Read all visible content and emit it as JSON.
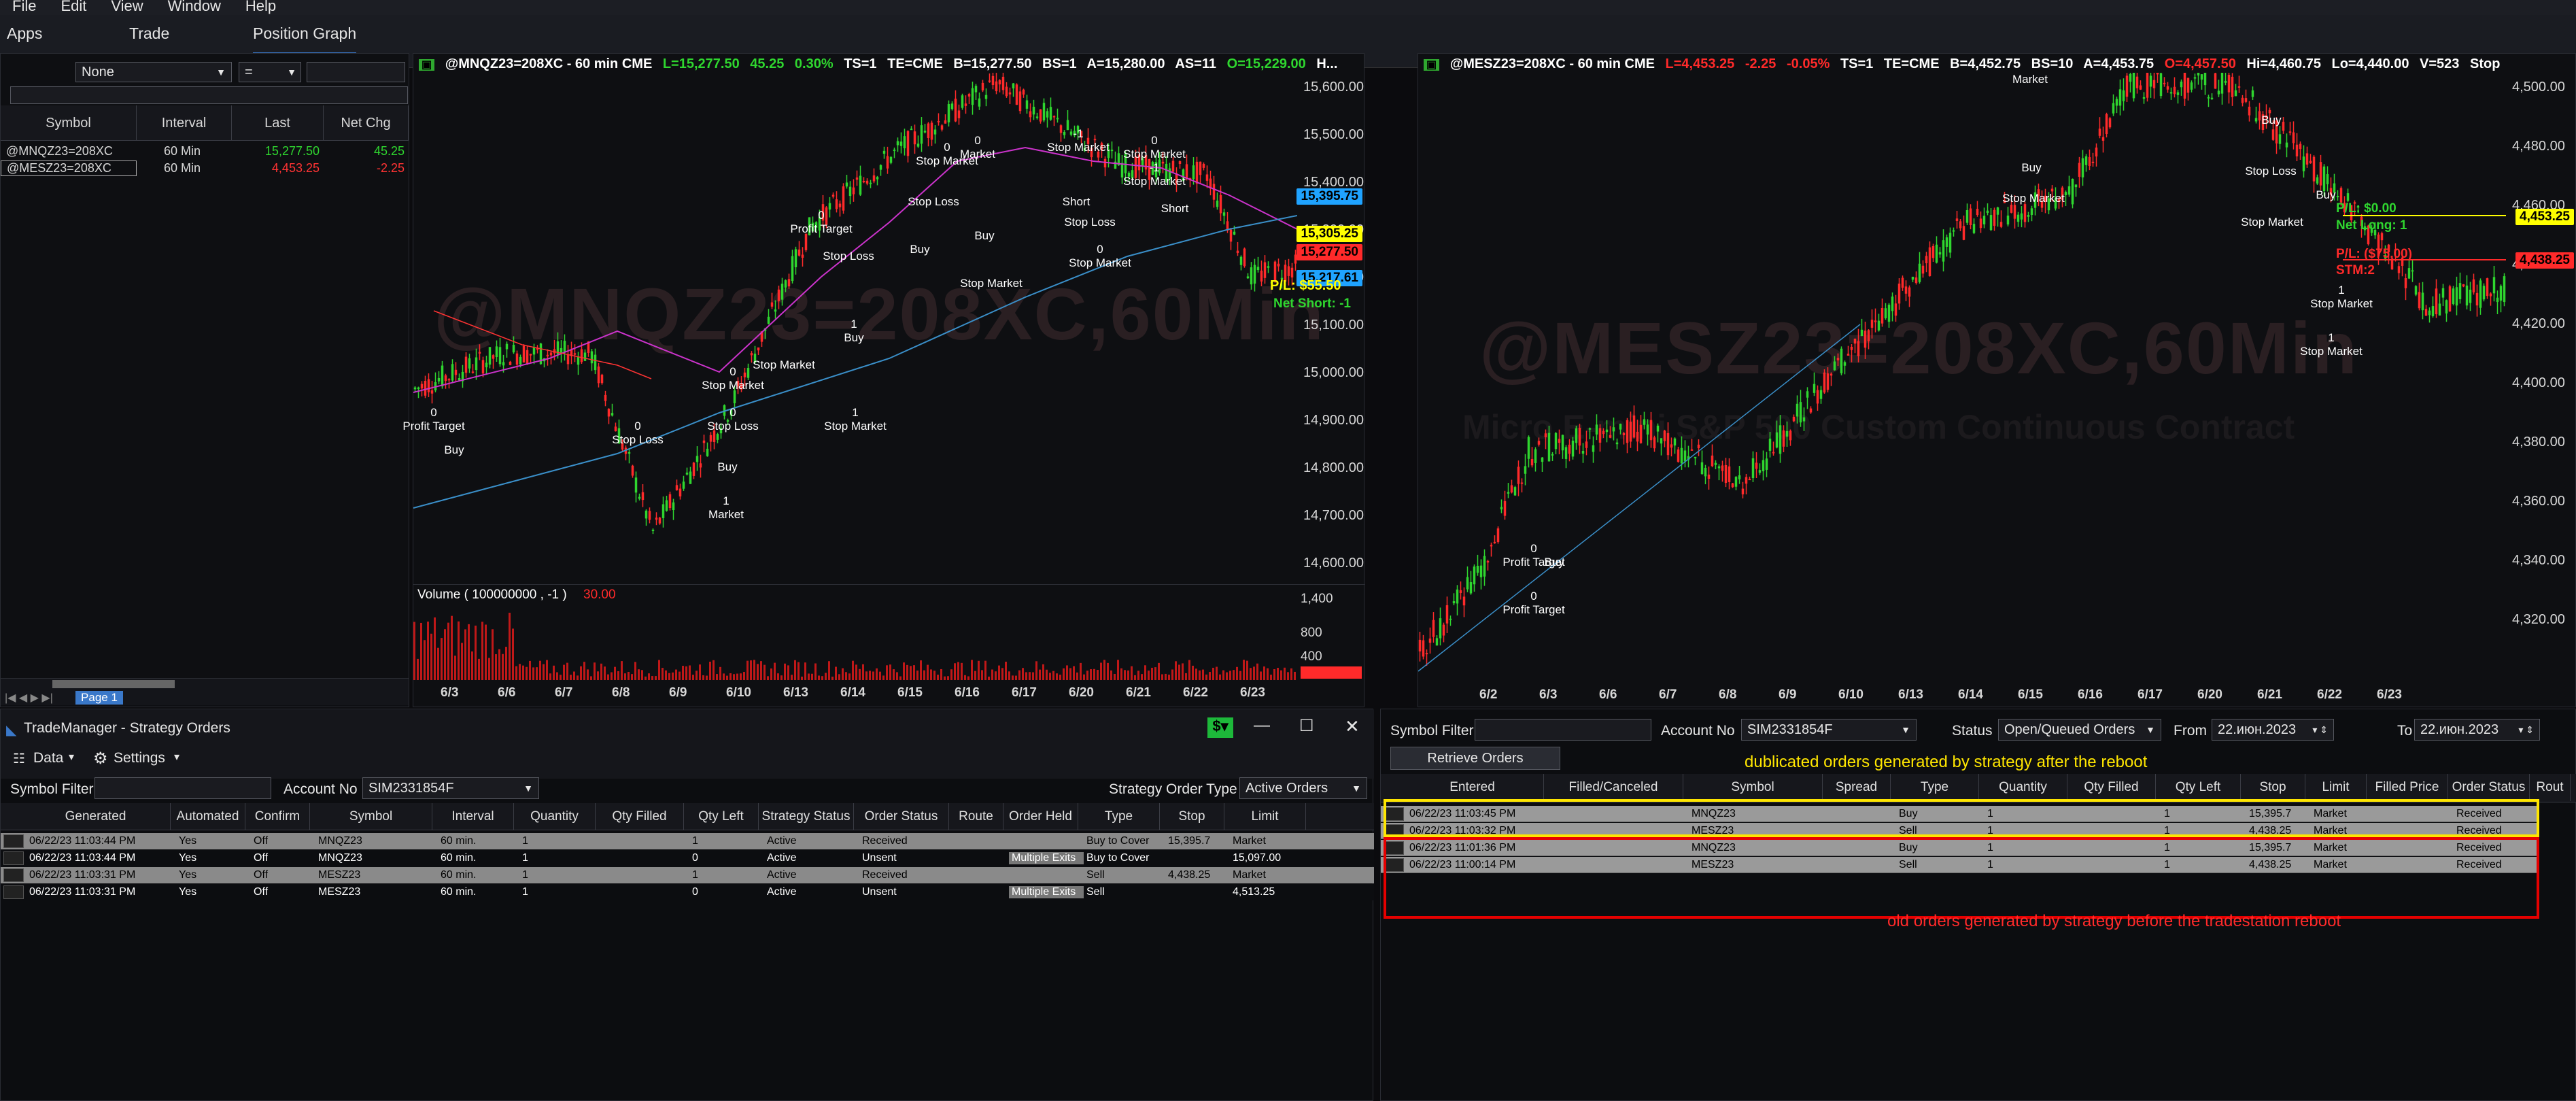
{
  "menu": [
    "File",
    "Edit",
    "View",
    "Window",
    "Help"
  ],
  "tabs": [
    {
      "label": "Apps"
    },
    {
      "label": "Trade"
    },
    {
      "label": "Position Graph"
    }
  ],
  "quotelist": {
    "filter_value": "None",
    "filter2": "=",
    "headers": [
      "Symbol",
      "Interval",
      "Last",
      "Net Chg"
    ],
    "rows": [
      {
        "symbol": "@MNQZ23=208XC",
        "interval": "60 Min",
        "last": "15,277.50",
        "net_chg": "45.25",
        "color": "#2fd62f"
      },
      {
        "symbol": "@MESZ23=208XC",
        "interval": "60 Min",
        "last": "4,453.25",
        "net_chg": "-2.25",
        "color": "#ff3333"
      }
    ],
    "page_tab": "Page 1"
  },
  "chart_left": {
    "title": {
      "symbol": "@MNQZ23=208XC - 60 min  CME",
      "last": "L=15,277.50",
      "chg": "45.25",
      "pct": "0.30%",
      "ts": "TS=1",
      "te": "TE=CME",
      "bid": "B=15,277.50",
      "bs": "BS=1",
      "ask": "A=15,280.00",
      "as": "AS=11",
      "open": "O=15,229.00",
      "hi": "H..."
    },
    "watermark": "@MNQZ23=208XC,60Min",
    "y_ticks": [
      "15,600.00",
      "15,500.00",
      "15,400.00",
      "15,300.00",
      "15,200.00",
      "15,100.00",
      "15,000.00",
      "14,900.00",
      "14,800.00",
      "14,700.00",
      "14,600.00"
    ],
    "price_tags": [
      {
        "text": "15,395.75",
        "bg": "#1fa3ff",
        "fg": "#000"
      },
      {
        "text": "15,305.25",
        "bg": "#ffff00",
        "fg": "#000"
      },
      {
        "text": "15,277.50",
        "bg": "#ff2a2a",
        "fg": "#000"
      },
      {
        "text": "15,217.61",
        "bg": "#1fa3ff",
        "fg": "#000"
      }
    ],
    "pl_text": "P/L: $55.50",
    "net_text": "Net Short: -1",
    "volume_label": "Volume ( 100000000 , -1 )",
    "volume_value": "30.00",
    "volume_ticks": [
      "1,400",
      "800",
      "400"
    ],
    "dates": [
      "6/3",
      "6/6",
      "6/7",
      "6/8",
      "6/9",
      "6/10",
      "6/13",
      "6/14",
      "6/15",
      "6/16",
      "6/17",
      "6/20",
      "6/21",
      "6/22",
      "6/23"
    ],
    "annotations": [
      {
        "text": "Profit Target",
        "sub": "0"
      },
      {
        "text": "Buy",
        "sub": ""
      },
      {
        "text": "Stop Loss",
        "sub": "0"
      },
      {
        "text": "Market",
        "sub": "1"
      },
      {
        "text": "Stop Market",
        "sub": "0"
      },
      {
        "text": "Stop Loss",
        "sub": "0"
      },
      {
        "text": "Buy",
        "sub": ""
      },
      {
        "text": "Stop Market",
        "sub": ""
      },
      {
        "text": "Profit Target",
        "sub": "0"
      },
      {
        "text": "Stop Loss",
        "sub": ""
      },
      {
        "text": "Buy",
        "sub": "1"
      },
      {
        "text": "Stop Market",
        "sub": "1"
      },
      {
        "text": "Stop Market",
        "sub": "0"
      },
      {
        "text": "Stop Loss",
        "sub": ""
      },
      {
        "text": "Buy",
        "sub": ""
      },
      {
        "text": "Market",
        "sub": "0"
      },
      {
        "text": "Buy",
        "sub": ""
      },
      {
        "text": "Stop Market",
        "sub": ""
      },
      {
        "text": "Stop Market",
        "sub": "-1"
      },
      {
        "text": "Short",
        "sub": ""
      },
      {
        "text": "Stop Loss",
        "sub": ""
      },
      {
        "text": "Stop Market",
        "sub": "0"
      },
      {
        "text": "Stop Market",
        "sub": "0"
      },
      {
        "text": "Stop Market",
        "sub": "-1"
      },
      {
        "text": "Short",
        "sub": ""
      }
    ]
  },
  "chart_right": {
    "title": {
      "symbol": "@MESZ23=208XC - 60 min  CME",
      "last": "L=4,453.25",
      "chg": "-2.25",
      "pct": "-0.05%",
      "ts": "TS=1",
      "te": "TE=CME",
      "bid": "B=4,452.75",
      "bs": "BS=10",
      "ask": "A=4,453.75",
      "as": "AS=10",
      "open": "O=4,457.50",
      "hi": "Hi=4,460.75",
      "lo": "Lo=4,440.00",
      "vol": "V=523",
      "stop": "Stop"
    },
    "watermark": "@MESZ23=208XC,60Min",
    "watermark_sub": "Micro E-mini S&P 500 Custom Continuous Contract",
    "y_ticks": [
      "4,500.00",
      "4,480.00",
      "4,460.00",
      "4,440.00",
      "4,420.00",
      "4,400.00",
      "4,380.00",
      "4,360.00",
      "4,340.00",
      "4,320.00"
    ],
    "price_tags": [
      {
        "text": "4,453.25",
        "bg": "#ffff00",
        "fg": "#000"
      },
      {
        "text": "4,438.25",
        "bg": "#ff2a2a",
        "fg": "#000"
      }
    ],
    "pl_text": "P/L: $0.00",
    "net_text": "Net Long: 1",
    "pl2_text": "P/L: ($75.00)",
    "stm_text": "STM:2",
    "dates": [
      "6/2",
      "6/3",
      "6/6",
      "6/7",
      "6/8",
      "6/9",
      "6/10",
      "6/13",
      "6/14",
      "6/15",
      "6/16",
      "6/17",
      "6/20",
      "6/21",
      "6/22",
      "6/23"
    ],
    "annotations": [
      {
        "text": "Profit Target",
        "sub": "0"
      },
      {
        "text": "Buy",
        "sub": ""
      },
      {
        "text": "Profit Target",
        "sub": "0"
      },
      {
        "text": "Market",
        "sub": ""
      },
      {
        "text": "Buy",
        "sub": ""
      },
      {
        "text": "Stop Market",
        "sub": ""
      },
      {
        "text": "Stop Market",
        "sub": ""
      },
      {
        "text": "Buy",
        "sub": ""
      },
      {
        "text": "Stop Loss",
        "sub": ""
      },
      {
        "text": "Stop Market",
        "sub": "1"
      },
      {
        "text": "Buy",
        "sub": ""
      },
      {
        "text": "Stop Market",
        "sub": "1"
      }
    ]
  },
  "strategy_orders": {
    "window_title": "TradeManager - Strategy Orders",
    "data_menu": "Data",
    "settings_menu": "Settings",
    "symbol_filter_label": "Symbol Filter",
    "account_label": "Account No",
    "account_value": "SIM2331854F",
    "order_type_label": "Strategy Order Type",
    "order_type_value": "Active Orders",
    "headers": [
      "Generated",
      "Automated",
      "Confirm",
      "Symbol",
      "Interval",
      "Quantity",
      "Qty Filled",
      "Qty Left",
      "Strategy Status",
      "Order Status",
      "Route",
      "Order Held",
      "Type",
      "Stop",
      "Limit"
    ],
    "rows": [
      [
        "06/22/23 11:03:44 PM",
        "Yes",
        "Off",
        "MNQZ23",
        "60 min.",
        "1",
        "",
        "1",
        "Active",
        "Received",
        "",
        "",
        "Buy to Cover",
        "15,395.7",
        "Market"
      ],
      [
        "06/22/23 11:03:44 PM",
        "Yes",
        "Off",
        "MNQZ23",
        "60 min.",
        "1",
        "",
        "0",
        "Active",
        "Unsent",
        "",
        "Multiple Exits",
        "Buy to Cover",
        "",
        "15,097.00"
      ],
      [
        "06/22/23 11:03:31 PM",
        "Yes",
        "Off",
        "MESZ23",
        "60 min.",
        "1",
        "",
        "1",
        "Active",
        "Received",
        "",
        "",
        "Sell",
        "4,438.25",
        "Market"
      ],
      [
        "06/22/23 11:03:31 PM",
        "Yes",
        "Off",
        "MESZ23",
        "60 min.",
        "1",
        "",
        "0",
        "Active",
        "Unsent",
        "",
        "Multiple Exits",
        "Sell",
        "",
        "4,513.25"
      ]
    ]
  },
  "orders": {
    "symbol_filter_label": "Symbol Filter",
    "account_label": "Account No",
    "account_value": "SIM2331854F",
    "status_label": "Status",
    "status_value": "Open/Queued Orders",
    "from_label": "From",
    "from_value": "22.июн.2023",
    "to_label": "To",
    "to_value": "22.июн.2023",
    "retrieve_button": "Retrieve Orders",
    "annotation_top": "dublicated orders generated by strategy after the reboot",
    "annotation_bottom": "old orders generated by strategy before the tradestation reboot",
    "headers": [
      "Entered",
      "Filled/Canceled",
      "Symbol",
      "Spread",
      "Type",
      "Quantity",
      "Qty Filled",
      "Qty Left",
      "Stop",
      "Limit",
      "Filled Price",
      "Order Status",
      "Rout"
    ],
    "rows": [
      [
        "06/22/23 11:03:45 PM",
        "",
        "MNQZ23",
        "",
        "Buy",
        "1",
        "",
        "1",
        "15,395.7",
        "Market",
        "",
        "Received"
      ],
      [
        "06/22/23 11:03:32 PM",
        "",
        "MESZ23",
        "",
        "Sell",
        "1",
        "",
        "1",
        "4,438.25",
        "Market",
        "",
        "Received"
      ],
      [
        "06/22/23 11:01:36 PM",
        "",
        "MNQZ23",
        "",
        "Buy",
        "1",
        "",
        "1",
        "15,395.7",
        "Market",
        "",
        "Received"
      ],
      [
        "06/22/23 11:00:14 PM",
        "",
        "MESZ23",
        "",
        "Sell",
        "1",
        "",
        "1",
        "4,438.25",
        "Market",
        "",
        "Received"
      ]
    ]
  },
  "colors": {
    "up": "#2fd62f",
    "down": "#ff2a2a",
    "highlight_yellow": "#ffe600",
    "highlight_red": "#e60000",
    "green_btn": "#1db83a"
  }
}
